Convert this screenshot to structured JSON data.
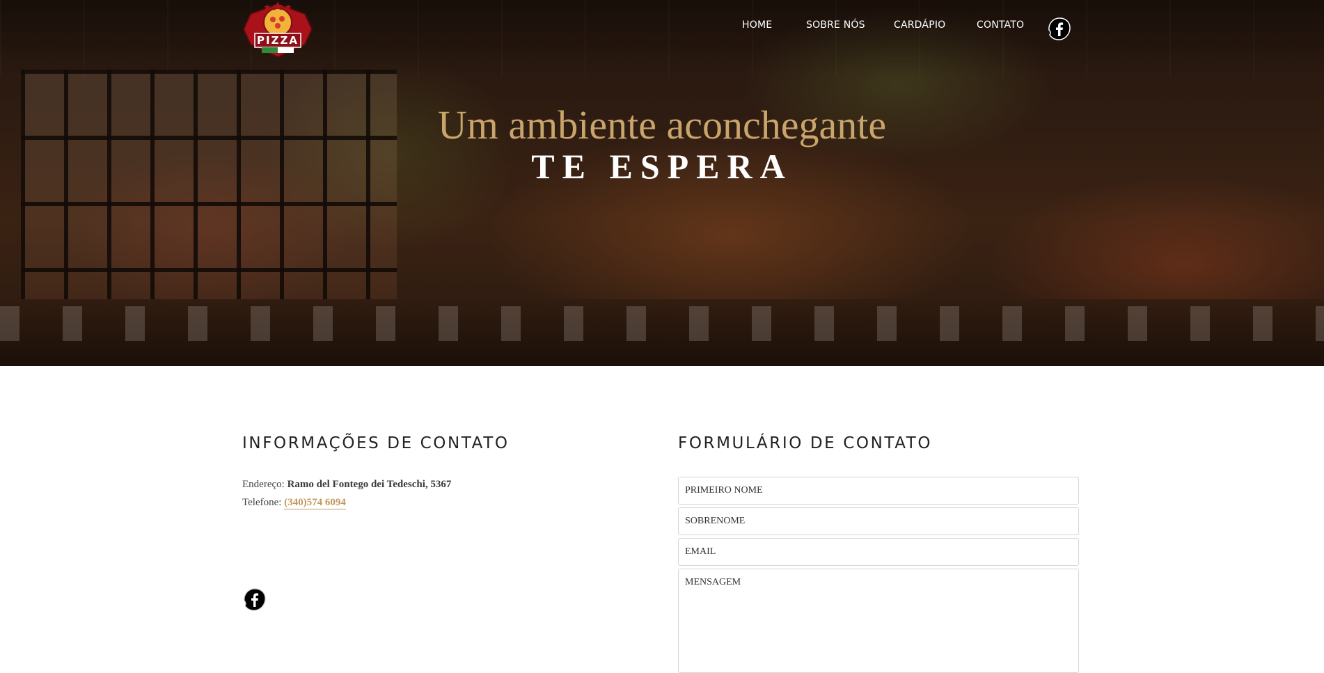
{
  "brand": {
    "logo_text": "PIZZA"
  },
  "nav": {
    "items": [
      {
        "label": "HOME"
      },
      {
        "label": "SOBRE NÓS"
      },
      {
        "label": "CARDÁPIO"
      },
      {
        "label": "CONTATO"
      }
    ],
    "social_icon": "facebook-icon"
  },
  "hero": {
    "line1": "Um ambiente aconchegante",
    "line2": "TE ESPERA"
  },
  "contact_info": {
    "title": "INFORMAÇÕES DE CONTATO",
    "address_label": "Endereço:",
    "address_value": "Ramo del Fontego dei Tedeschi, 5367",
    "phone_label": "Telefone:",
    "phone_value": "(340)574 6094",
    "social_icon": "facebook-icon"
  },
  "contact_form": {
    "title": "FORMULÁRIO DE CONTATO",
    "first_name_placeholder": "PRIMEIRO NOME",
    "last_name_placeholder": "SOBRENOME",
    "email_placeholder": "EMAIL",
    "message_placeholder": "MENSAGEM"
  },
  "colors": {
    "accent_gold": "#c2985c",
    "hero_gold": "#c9a46b",
    "heading": "#222222"
  }
}
